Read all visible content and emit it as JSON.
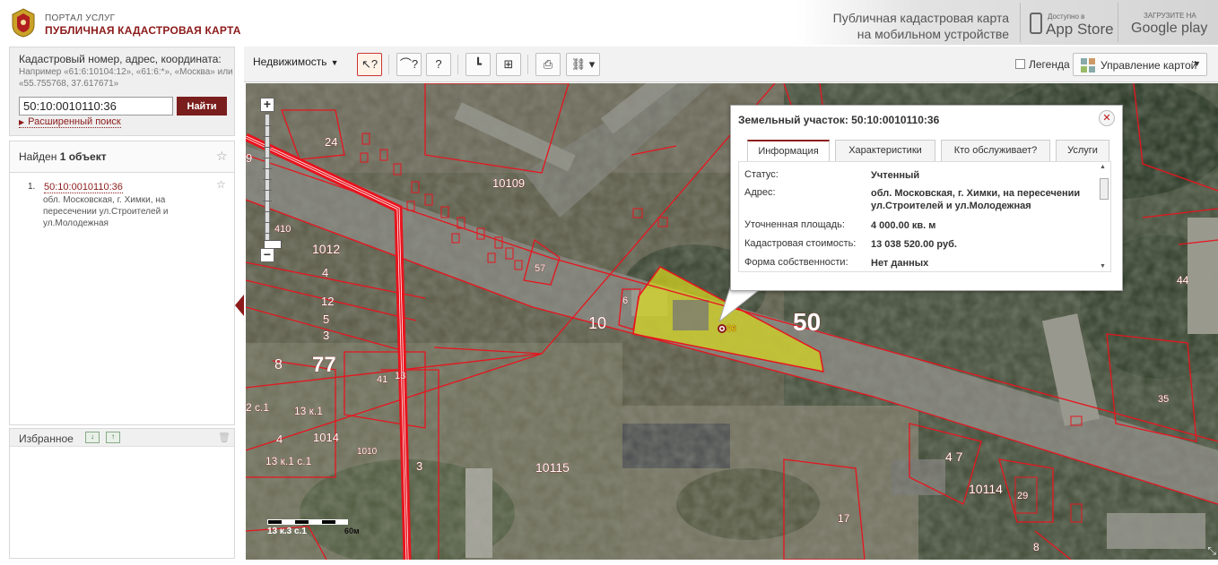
{
  "header": {
    "portal_small": "ПОРТАЛ УСЛУГ",
    "portal_big": "ПУБЛИЧНАЯ КАДАСТРОВАЯ КАРТА",
    "promo_line1": "Публичная кадастровая карта",
    "promo_line2": "на мобильном устройстве",
    "appstore_small": "Доступно в",
    "appstore_big": "App Store",
    "gplay_small": "ЗАГРУЗИТЕ НА",
    "gplay_big": "Google play"
  },
  "search": {
    "label": "Кадастровый номер, адрес, координата:",
    "hint": "Например «61:6:10104:12», «61:6:*», «Москва» или «55.755768, 37.617671»",
    "value": "50:10:0010110:36",
    "button": "Найти",
    "advanced": "Расширенный поиск"
  },
  "found": {
    "prefix": "Найден",
    "count": "1 объект"
  },
  "results": [
    {
      "num": "1.",
      "id": "50:10:0010110:36",
      "address": "обл. Московская, г. Химки, на пересечении ул.Строителей и ул.Молодежная"
    }
  ],
  "favorites": {
    "title": "Избранное"
  },
  "toolbar": {
    "layer_select": "Недвижимость",
    "legend": "Легенда",
    "map_manage": "Управление картой"
  },
  "popup": {
    "title": "Земельный участок: 50:10:0010110:36",
    "tabs": [
      "Информация",
      "Характеристики",
      "Кто обслуживает?",
      "Услуги"
    ],
    "rows": [
      {
        "k": "Статус:",
        "v": "Учтенный"
      },
      {
        "k": "Адрес:",
        "v": "обл. Московская, г. Химки, на пересечении ул.Строителей и ул.Молодежная"
      },
      {
        "k": "Уточненная площадь:",
        "v": "4 000.00 кв. м"
      },
      {
        "k": "Кадастровая стоимость:",
        "v": "13 038 520.00 руб."
      },
      {
        "k": "Форма собственности:",
        "v": "Нет данных"
      }
    ]
  },
  "map_labels": {
    "l24": "24",
    "l10109": "10109",
    "l57": "57",
    "l1012": "1012",
    "l4a": "4",
    "l12": "12",
    "l5": "5",
    "l3a": "3",
    "l8": "8",
    "l77": "77",
    "l41": "41",
    "l13": "13",
    "l13k1": "13 к.1",
    "lc1": "2 с.1",
    "l4b": "4",
    "l1014": "1014",
    "l1010": "1010",
    "l13k1c1": "13 к.1 с.1",
    "l3b": "3",
    "l10115": "10115",
    "l10": "10",
    "l6": "6",
    "l36": "36",
    "l50": "50",
    "l44": "44",
    "l35": "35",
    "l47": "4 7",
    "l10114": "10114",
    "l29": "29",
    "l17": "17",
    "l8b": "8",
    "l410": "410",
    "l9": "9",
    "scale_text": "13 к.3 с.1",
    "scale_unit": "60м"
  },
  "colors": {
    "brand": "#8c1a1a",
    "boundary": "#e8141e",
    "parcel_fill": "#d8d81c"
  }
}
